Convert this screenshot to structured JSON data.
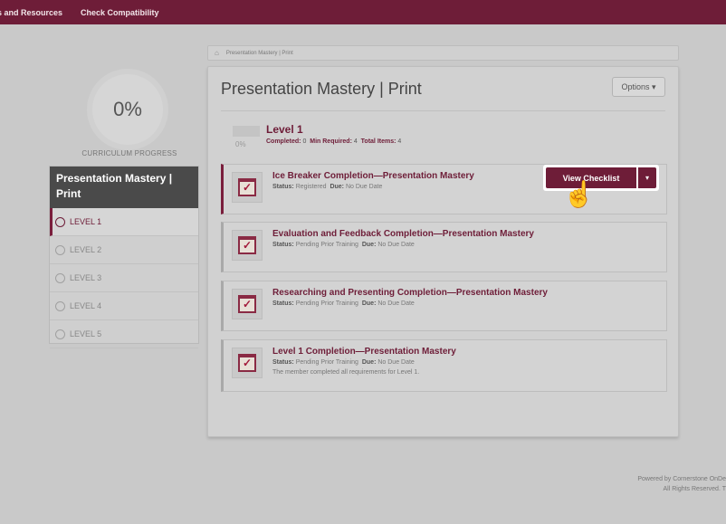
{
  "topbar": {
    "links": [
      "s and Resources",
      "Check Compatibility"
    ]
  },
  "progress": {
    "value": "0%",
    "label": "CURRICULUM PROGRESS"
  },
  "curriculum": {
    "title": "Presentation Mastery | Print",
    "levels": [
      "LEVEL 1",
      "LEVEL 2",
      "LEVEL 3",
      "LEVEL 4",
      "LEVEL 5"
    ]
  },
  "breadcrumb": {
    "text": "Presentation Mastery | Print"
  },
  "page": {
    "title": "Presentation Mastery | Print",
    "options_label": "Options ▾"
  },
  "level": {
    "pct": "0%",
    "name": "Level 1",
    "completed_label": "Completed:",
    "completed": "0",
    "min_label": "Min Required:",
    "min": "4",
    "total_label": "Total Items:",
    "total": "4"
  },
  "items": [
    {
      "title": "Ice Breaker Completion—Presentation Mastery",
      "status_label": "Status:",
      "status": "Registered",
      "due_label": "Due:",
      "due": "No Due Date",
      "note": ""
    },
    {
      "title": "Evaluation and Feedback Completion—Presentation Mastery",
      "status_label": "Status:",
      "status": "Pending Prior Training",
      "due_label": "Due:",
      "due": "No Due Date",
      "note": ""
    },
    {
      "title": "Researching and Presenting Completion—Presentation Mastery",
      "status_label": "Status:",
      "status": "Pending Prior Training",
      "due_label": "Due:",
      "due": "No Due Date",
      "note": ""
    },
    {
      "title": "Level 1 Completion—Presentation Mastery",
      "status_label": "Status:",
      "status": "Pending Prior Training",
      "due_label": "Due:",
      "due": "No Due Date",
      "note": "The member completed all requirements for Level 1."
    }
  ],
  "view_checklist": {
    "label": "View Checklist",
    "dropdown": "▾"
  },
  "footer": {
    "line1": "Powered by Cornerstone OnDe",
    "line2": "All Rights Reserved. T"
  },
  "colors": {
    "brand": "#6e1d38",
    "panel": "#d1d1d1"
  }
}
